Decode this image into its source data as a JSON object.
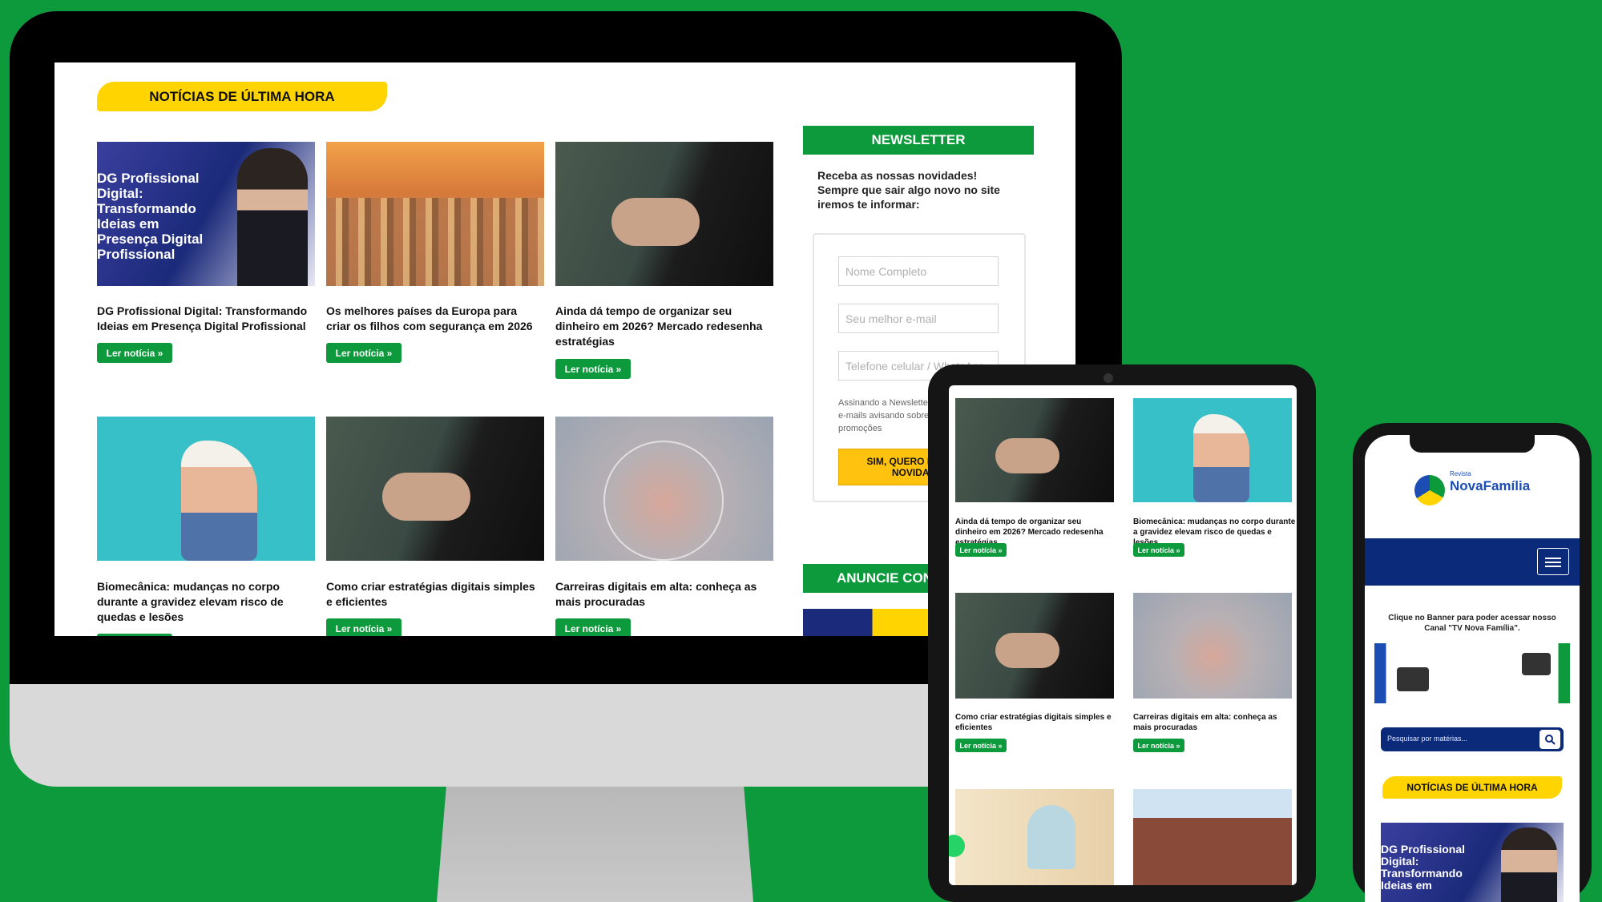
{
  "desktop": {
    "section_title": "NOTÍCIAS DE ÚLTIMA HORA",
    "read_more": "Ler notícia »",
    "thumb_promo_text": "DG Profissional Digital: Transformando Ideias em Presença Digital Profissional",
    "articles": [
      {
        "title": "DG Profissional Digital: Transformando Ideias em Presença Digital Profissional"
      },
      {
        "title": "Os melhores países da Europa para criar os filhos com segurança em 2026"
      },
      {
        "title": "Ainda dá tempo de organizar seu dinheiro em 2026? Mercado redesenha estratégias"
      },
      {
        "title": "Biomecânica: mudanças no corpo durante a gravidez elevam risco de quedas e lesões"
      },
      {
        "title": "Como criar estratégias digitais simples e eficientes"
      },
      {
        "title": "Carreiras digitais em alta: conheça as mais procuradas"
      }
    ],
    "newsletter": {
      "heading": "NEWSLETTER",
      "intro": "Receba as nossas novidades! Sempre que sair algo novo no site iremos te informar:",
      "name_placeholder": "Nome Completo",
      "email_placeholder": "Seu melhor e-mail",
      "phone_placeholder": "Telefone celular / WhatsApp",
      "disclaimer": "Assinando a Newsletter você irá receber e-mails avisando sobre conteúdo novo e promoções",
      "submit_label": "SIM, QUERO RECEBER NOVIDADES"
    },
    "advertise_heading": "ANUNCIE CONOSCO"
  },
  "tablet": {
    "read_more": "Ler notícia »",
    "articles": [
      {
        "title": "Ainda dá tempo de organizar seu dinheiro em 2026? Mercado redesenha estratégias"
      },
      {
        "title": "Biomecânica: mudanças no corpo durante a gravidez elevam risco de quedas e lesões"
      },
      {
        "title": "Como criar estratégias digitais simples e eficientes"
      },
      {
        "title": "Carreiras digitais em alta: conheça as mais procuradas"
      }
    ]
  },
  "phone": {
    "logo_small": "Revista",
    "logo_name": "NovaFamília",
    "banner_caption": "Clique no Banner para poder acessar nosso Canal \"TV Nova Família\".",
    "search_placeholder": "Pesquisar por matérias...",
    "section_title": "NOTÍCIAS DE ÚLTIMA HORA",
    "thumb_promo_text": "DG Profissional Digital: Transformando Ideias em"
  },
  "colors": {
    "green": "#0d9a3c",
    "yellow": "#ffd400",
    "navy": "#0b2a7a"
  }
}
